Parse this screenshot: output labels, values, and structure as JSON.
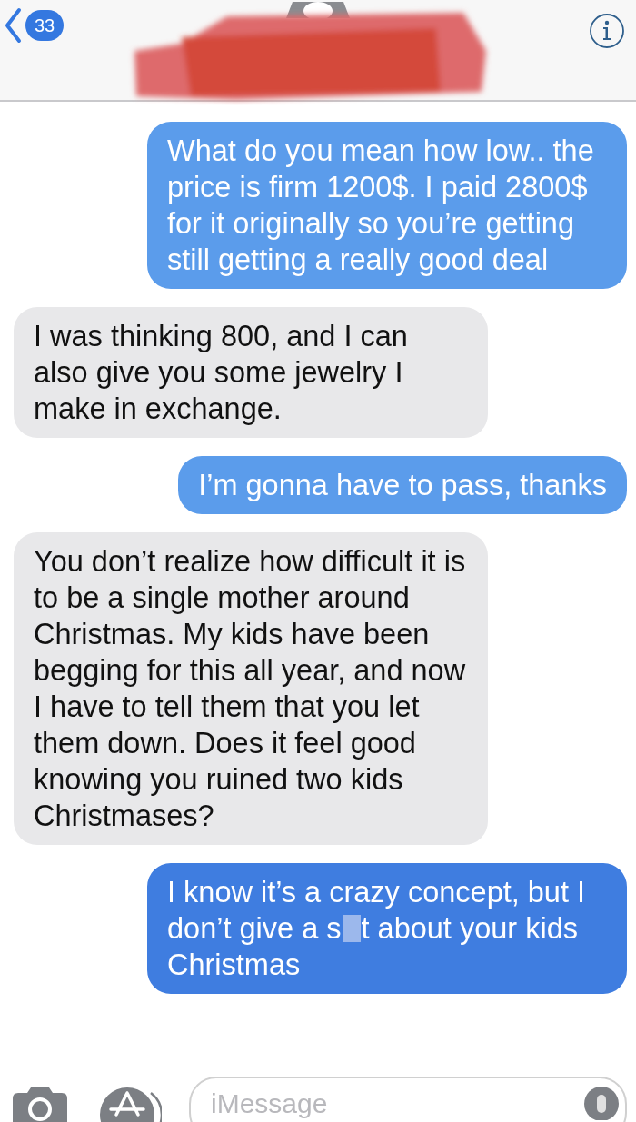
{
  "header": {
    "back_badge": "33"
  },
  "messages": [
    {
      "kind": "sent",
      "text": "What do you mean how low.. the price is firm 1200$. I paid 2800$ for it originally so you’re getting still getting a really good deal"
    },
    {
      "kind": "received",
      "text": "I was thinking 800, and I can also give you some jewelry I make in exchange."
    },
    {
      "kind": "sent",
      "text": "I’m gonna have to pass, thanks"
    },
    {
      "kind": "received",
      "text": "You don’t realize how difficult it is to be a single mother around Christmas. My kids have been begging for this all year, and now I have to tell them that you let them down. Does it feel good knowing you ruined two kids Christmases?"
    },
    {
      "kind": "sent",
      "text": "I know it’s a crazy concept, but I don’t give a s",
      "censored": true,
      "text_after": "t about your kids Christmas"
    }
  ],
  "composer": {
    "placeholder": "iMessage"
  }
}
